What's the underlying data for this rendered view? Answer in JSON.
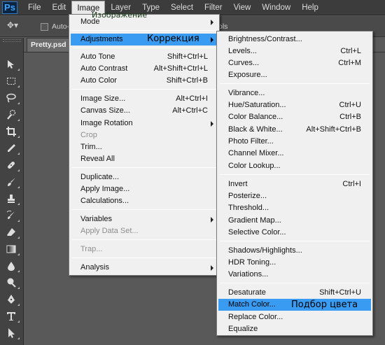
{
  "menubar": {
    "logo": "Ps",
    "items": [
      "File",
      "Edit",
      "Image",
      "Layer",
      "Type",
      "Select",
      "Filter",
      "View",
      "Window",
      "Help"
    ],
    "active": "Image"
  },
  "options_bar": {
    "auto_select_label": "Auto-",
    "right_text": "ols"
  },
  "document_tab": {
    "title": "Pretty.psd @"
  },
  "annotations": {
    "image_ru": "Изображение",
    "adjustments_ru": "Коррекция",
    "match_color_ru": "Подбор цвета"
  },
  "image_menu": {
    "mode": "Mode",
    "adjustments": "Adjustments",
    "auto_tone": "Auto Tone",
    "auto_tone_sc": "Shift+Ctrl+L",
    "auto_contrast": "Auto Contrast",
    "auto_contrast_sc": "Alt+Shift+Ctrl+L",
    "auto_color": "Auto Color",
    "auto_color_sc": "Shift+Ctrl+B",
    "image_size": "Image Size...",
    "image_size_sc": "Alt+Ctrl+I",
    "canvas_size": "Canvas Size...",
    "canvas_size_sc": "Alt+Ctrl+C",
    "image_rotation": "Image Rotation",
    "crop": "Crop",
    "trim": "Trim...",
    "reveal_all": "Reveal All",
    "duplicate": "Duplicate...",
    "apply_image": "Apply Image...",
    "calculations": "Calculations...",
    "variables": "Variables",
    "apply_data_set": "Apply Data Set...",
    "trap": "Trap...",
    "analysis": "Analysis"
  },
  "adjustments_menu": {
    "brightness_contrast": "Brightness/Contrast...",
    "levels": "Levels...",
    "levels_sc": "Ctrl+L",
    "curves": "Curves...",
    "curves_sc": "Ctrl+M",
    "exposure": "Exposure...",
    "vibrance": "Vibrance...",
    "hue_saturation": "Hue/Saturation...",
    "hue_saturation_sc": "Ctrl+U",
    "color_balance": "Color Balance...",
    "color_balance_sc": "Ctrl+B",
    "black_white": "Black & White...",
    "black_white_sc": "Alt+Shift+Ctrl+B",
    "photo_filter": "Photo Filter...",
    "channel_mixer": "Channel Mixer...",
    "color_lookup": "Color Lookup...",
    "invert": "Invert",
    "invert_sc": "Ctrl+I",
    "posterize": "Posterize...",
    "threshold": "Threshold...",
    "gradient_map": "Gradient Map...",
    "selective_color": "Selective Color...",
    "shadows_highlights": "Shadows/Highlights...",
    "hdr_toning": "HDR Toning...",
    "variations": "Variations...",
    "desaturate": "Desaturate",
    "desaturate_sc": "Shift+Ctrl+U",
    "match_color": "Match Color...",
    "replace_color": "Replace Color...",
    "equalize": "Equalize"
  },
  "colors": {
    "highlight": "#3a9bf2",
    "menu_bg": "#f0f0f0",
    "app_bg": "#5a5a5a",
    "menubar_bg": "#3c3c3c"
  }
}
